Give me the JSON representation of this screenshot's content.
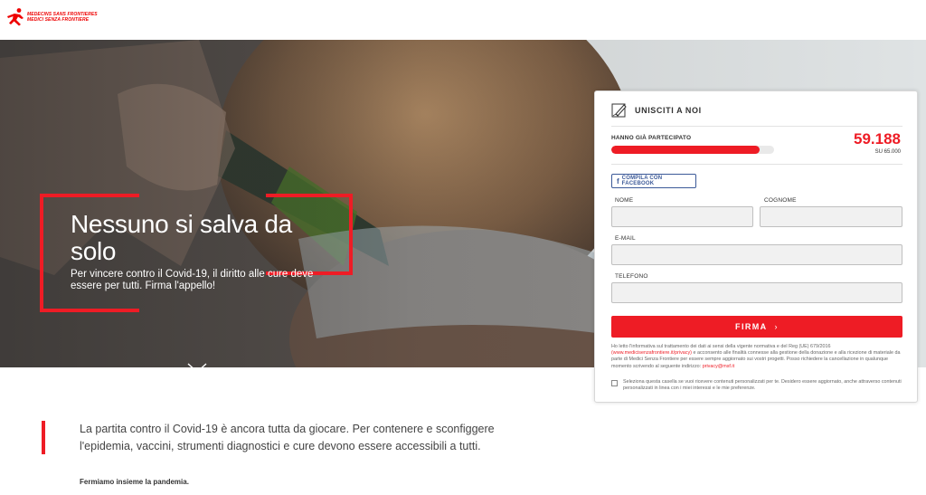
{
  "header": {
    "logo_line1": "MEDECINS SANS FRONTIERES",
    "logo_line2": "MEDICI SENZA FRONTIERE"
  },
  "hero": {
    "title": "Nessuno si salva da solo",
    "subtitle": "Per vincere contro il Covid-19, il diritto alle cure deve essere per tutti. Firma l'appello!",
    "scroll_icon": "chevron-down-icon"
  },
  "form": {
    "heading": "UNISCITI A NOI",
    "heading_icon": "pen-signature-icon",
    "progress_label": "HANNO GIÀ PARTECIPATO",
    "count": "59.188",
    "goal": "SU 65.000",
    "progress_fraction": 0.91,
    "facebook_label": "COMPILA CON FACEBOOK",
    "facebook_icon": "facebook-icon",
    "first_name_label": "NOME",
    "last_name_label": "COGNOME",
    "email_label": "E-MAIL",
    "phone_label": "TELEFONO",
    "first_name_value": "",
    "last_name_value": "",
    "email_value": "",
    "phone_value": "",
    "submit_label": "FIRMA",
    "privacy_text_1": "Ho letto l'informativa sul trattamento dei dati ai sensi della vigente normativa e del Reg (UE) 679/2016",
    "privacy_link_1": "(www.medicisenzafrontiere.it/privacy)",
    "privacy_text_2": "e acconsento alle finalità connesse alla gestione della donazione e alla ricezione di materiale da parte di Medici Senza Frontiere per essere sempre aggiornato sui vostri progetti. Posso richiedere la cancellazione in qualunque momento scrivendo al seguente indirizzo:",
    "privacy_link_2": "privacy@msf.it",
    "consent_text": "Seleziona questa casella se vuoi ricevere contenuti personalizzati per te. Desidero essere aggiornato, anche attraverso contenuti personalizzati in linea con i miei interessi e le mie preferenze."
  },
  "content": {
    "lead": "La partita contro il Covid-19 è ancora tutta da giocare. Per contenere e sconfiggere l'epidemia, vaccini, strumenti diagnostici e cure devono essere accessibili a tutti.",
    "strong": "Fermiamo insieme la pandemia."
  },
  "colors": {
    "brand_red": "#ee1c25",
    "facebook_blue": "#3b5998"
  }
}
